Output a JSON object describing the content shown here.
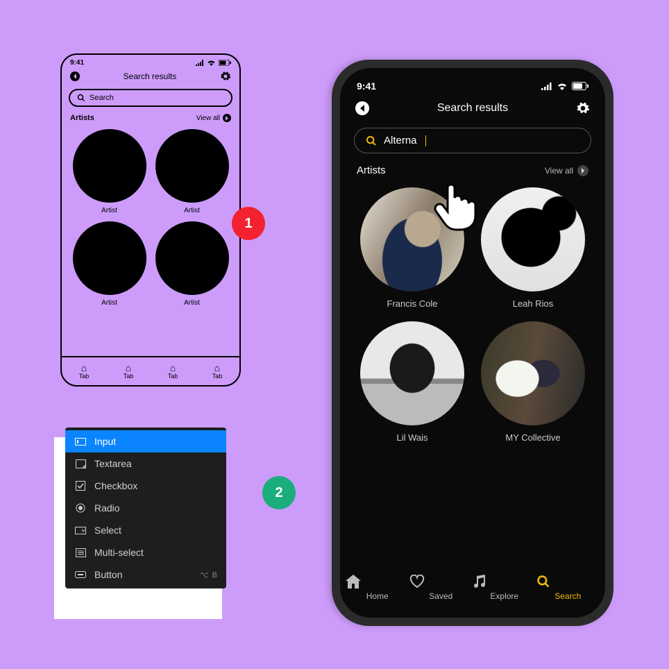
{
  "wire": {
    "time": "9:41",
    "header": "Search results",
    "search_placeholder": "Search",
    "section": "Artists",
    "viewall": "View all",
    "artist_label": "Artist",
    "tab_label": "Tab"
  },
  "badges": {
    "one": "1",
    "two": "2"
  },
  "menu": {
    "items": [
      {
        "label": "Input",
        "selected": true
      },
      {
        "label": "Textarea",
        "selected": false
      },
      {
        "label": "Checkbox",
        "selected": false
      },
      {
        "label": "Radio",
        "selected": false
      },
      {
        "label": "Select",
        "selected": false
      },
      {
        "label": "Multi-select",
        "selected": false
      },
      {
        "label": "Button",
        "selected": false,
        "shortcut": "⌥ B"
      }
    ]
  },
  "phone": {
    "time": "9:41",
    "header": "Search results",
    "search_value": "Alterna",
    "section": "Artists",
    "viewall": "View all",
    "artists": [
      {
        "name": "Francis Cole"
      },
      {
        "name": "Leah Rios"
      },
      {
        "name": "Lil Wais"
      },
      {
        "name": "MY Collective"
      }
    ],
    "tabs": [
      {
        "label": "Home",
        "active": false
      },
      {
        "label": "Saved",
        "active": false
      },
      {
        "label": "Explore",
        "active": false
      },
      {
        "label": "Search",
        "active": true
      }
    ]
  }
}
